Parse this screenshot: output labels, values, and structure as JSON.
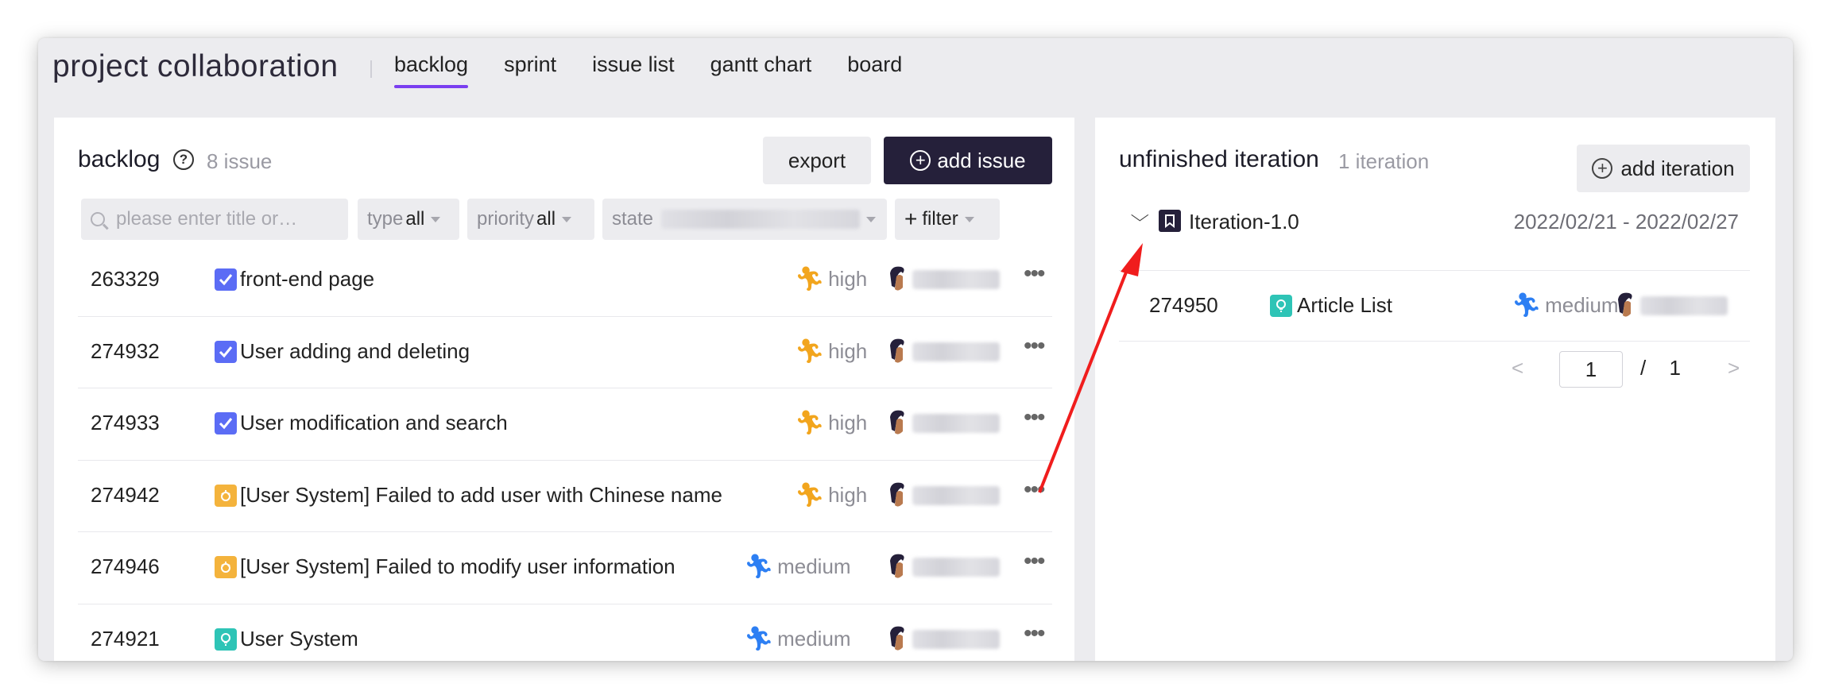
{
  "header": {
    "app_title": "project collaboration",
    "tabs": [
      {
        "label": "backlog",
        "active": true
      },
      {
        "label": "sprint",
        "active": false
      },
      {
        "label": "issue list",
        "active": false
      },
      {
        "label": "gantt chart",
        "active": false
      },
      {
        "label": "board",
        "active": false
      }
    ]
  },
  "backlog": {
    "title": "backlog",
    "count": "8 issue",
    "export_label": "export",
    "add_issue_label": "add issue",
    "search_placeholder": "please enter title or…",
    "filters": {
      "type_label": "type",
      "type_value": "all",
      "priority_label": "priority",
      "priority_value": "all",
      "state_label": "state",
      "filter_label": "filter"
    },
    "rows": [
      {
        "id": "263329",
        "type": "task",
        "title": "front-end page",
        "priority": "high"
      },
      {
        "id": "274932",
        "type": "task",
        "title": "User adding and deleting",
        "priority": "high"
      },
      {
        "id": "274933",
        "type": "task",
        "title": "User modification and search",
        "priority": "high"
      },
      {
        "id": "274942",
        "type": "bug",
        "title": "[User System] Failed to add user with Chinese name",
        "priority": "high"
      },
      {
        "id": "274946",
        "type": "bug",
        "title": "[User System] Failed to modify user information",
        "priority": "medium"
      },
      {
        "id": "274921",
        "type": "story",
        "title": "User System",
        "priority": "medium"
      }
    ]
  },
  "iterations": {
    "title": "unfinished iteration",
    "count": "1 iteration",
    "add_label": "add iteration",
    "items": [
      {
        "name": "Iteration-1.0",
        "dates": "2022/02/21 - 2022/02/27",
        "issues": [
          {
            "id": "274950",
            "type": "story",
            "title": "Article List",
            "priority": "medium"
          }
        ]
      }
    ],
    "pagination": {
      "current": "1",
      "separator": "/",
      "total": "1"
    }
  },
  "colors": {
    "accent": "#7a3ff0",
    "primary_button": "#25203a",
    "task_icon": "#5b6cf5",
    "bug_icon": "#f4b33c",
    "story_icon": "#2ec4b6",
    "priority_high": "#f2a51d",
    "priority_medium": "#2d7ff3",
    "annotation_arrow": "#f01d1d"
  },
  "icons": {
    "help": "question-circle-icon",
    "search": "search-icon",
    "add": "plus-circle-icon",
    "collapse": "chevron-down-icon",
    "iteration": "flag-icon",
    "more": "more-icon",
    "priority": "runner-icon",
    "prev": "chevron-left-icon",
    "next": "chevron-right-icon"
  }
}
